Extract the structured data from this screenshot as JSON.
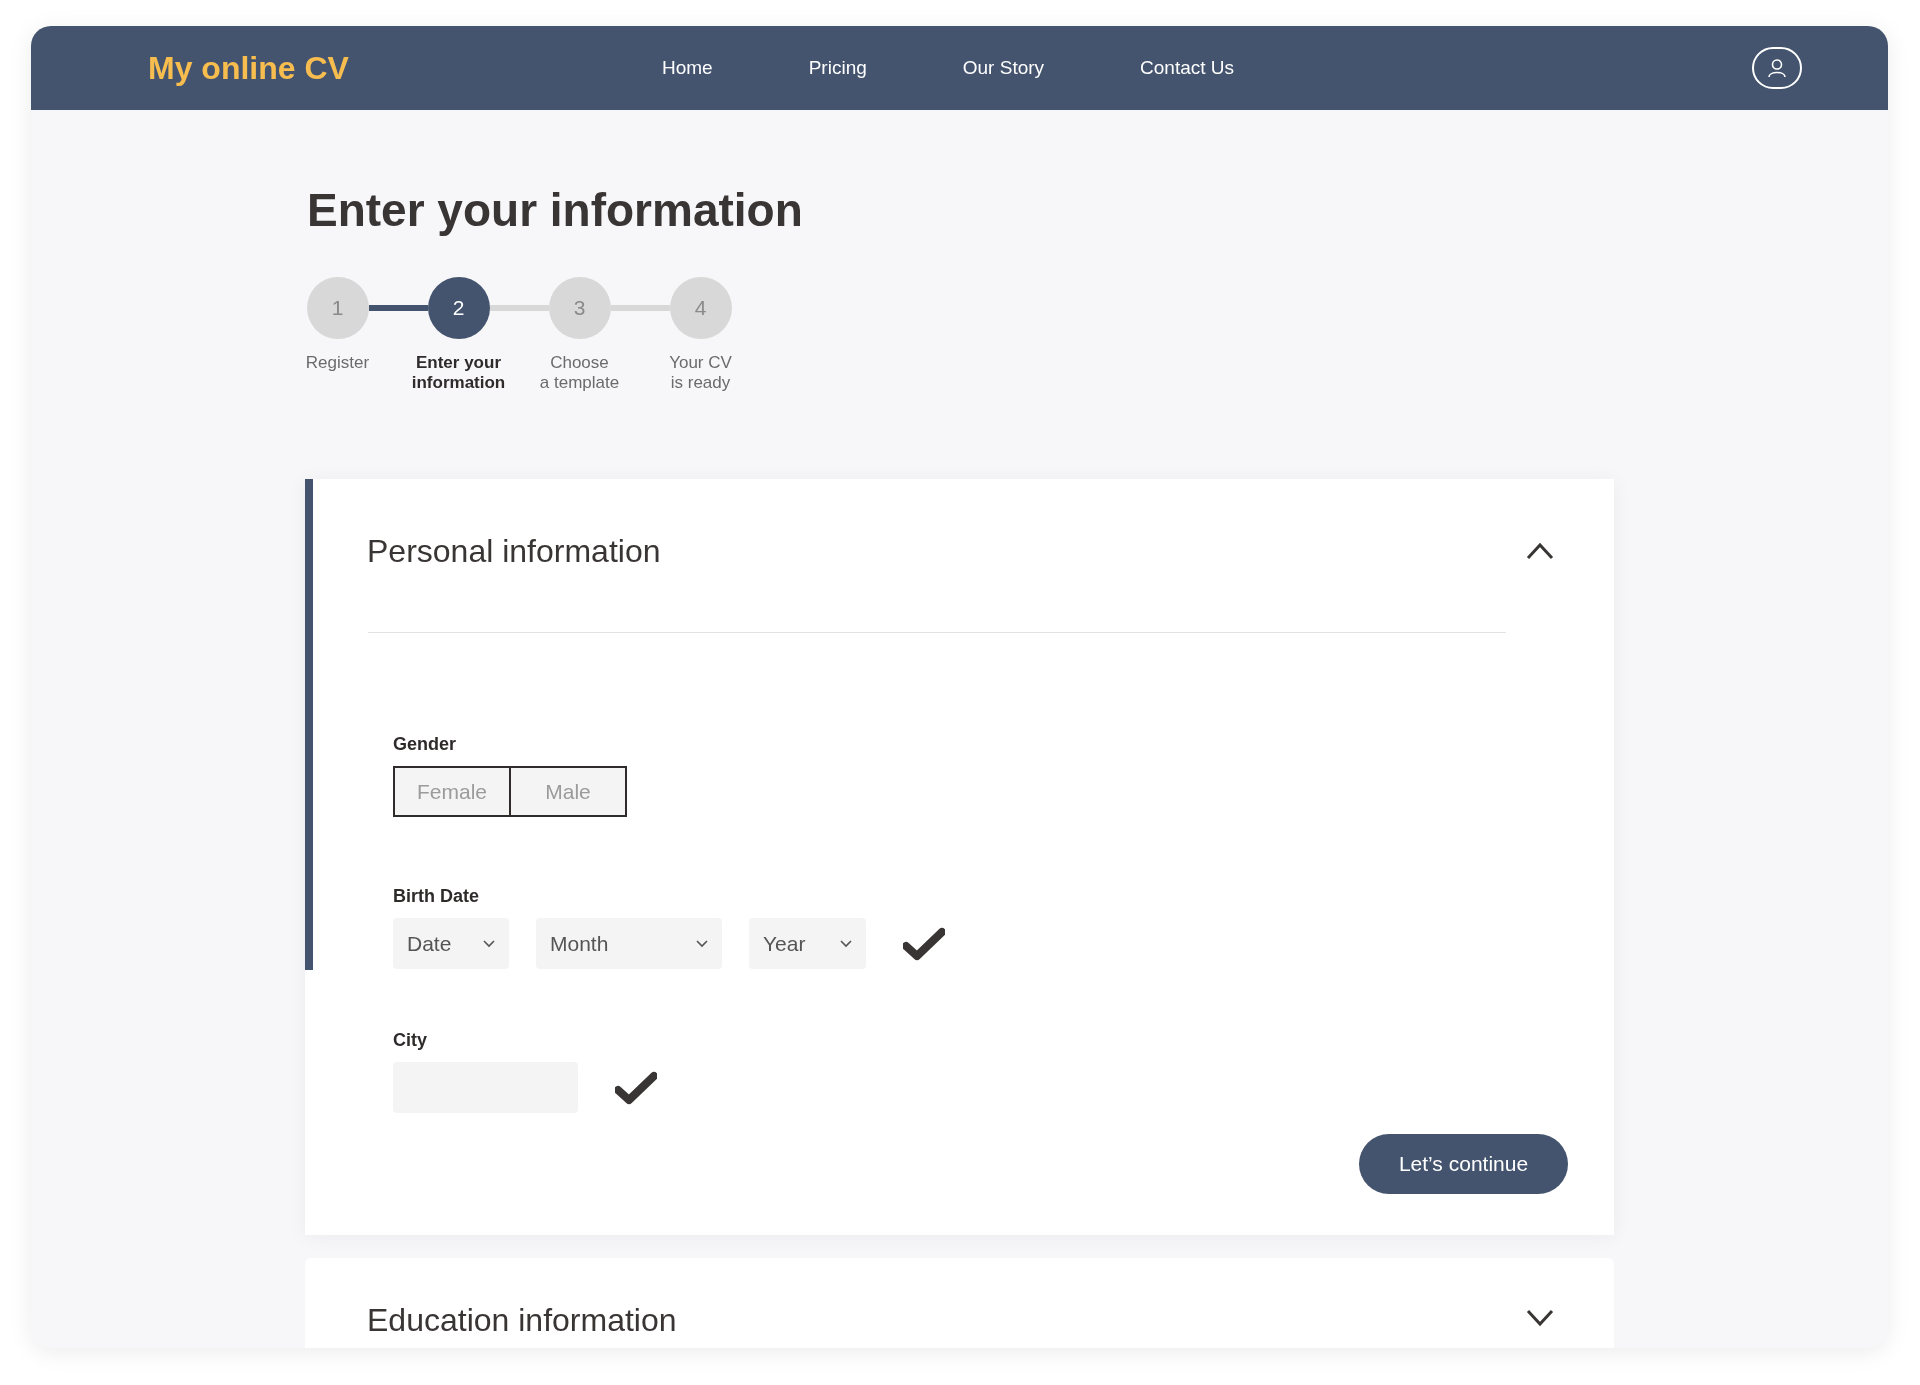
{
  "header": {
    "logo": "My online CV",
    "nav": [
      {
        "label": "Home"
      },
      {
        "label": "Pricing"
      },
      {
        "label": "Our Story"
      },
      {
        "label": "Contact Us"
      }
    ]
  },
  "title": "Enter your information",
  "steps": [
    {
      "number": "1",
      "label": "Register",
      "selected": false,
      "completed": true
    },
    {
      "number": "2",
      "label": "Enter your information",
      "selected": true,
      "completed": false
    },
    {
      "number": "3",
      "label": "Choose\na template",
      "selected": false,
      "completed": false
    },
    {
      "number": "4",
      "label": "Your CV\nis ready",
      "selected": false
    }
  ],
  "sections": [
    {
      "title": "Personal information",
      "expanded": true,
      "gender": {
        "label": "Gender",
        "options": [
          {
            "label": "Female",
            "selected": false
          },
          {
            "label": "Male",
            "selected": false
          }
        ]
      },
      "birth_date": {
        "label": "Birth Date",
        "selects": [
          {
            "placeholder": "Date"
          },
          {
            "placeholder": "Month"
          },
          {
            "placeholder": "Year"
          }
        ],
        "valid": true
      },
      "city": {
        "label": "City",
        "valid": true
      },
      "button": "Let’s continue"
    },
    {
      "title": "Education information",
      "expanded": false
    }
  ]
}
